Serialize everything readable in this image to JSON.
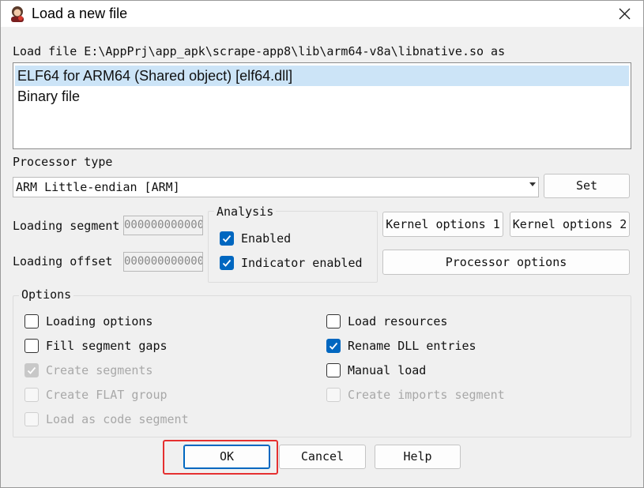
{
  "window": {
    "title": "Load a new file",
    "close_icon": "close-icon"
  },
  "load_file": {
    "label": "Load file E:\\AppPrj\\app_apk\\scrape-app8\\lib\\arm64-v8a\\libnative.so as"
  },
  "formats": [
    {
      "label": "ELF64 for ARM64 (Shared object) [elf64.dll]",
      "selected": true
    },
    {
      "label": "Binary file",
      "selected": false
    }
  ],
  "processor": {
    "label": "Processor type",
    "value": "ARM Little-endian [ARM]",
    "set_button": "Set"
  },
  "segment": {
    "loading_segment_label": "Loading segment",
    "loading_segment_value": "0000000000000",
    "loading_offset_label": "Loading offset",
    "loading_offset_value": "0000000000000"
  },
  "analysis": {
    "title": "Analysis",
    "enabled": {
      "label": "Enabled",
      "checked": true
    },
    "indicator": {
      "label": "Indicator enabled",
      "checked": true
    }
  },
  "buttons": {
    "kernel1": "Kernel options 1",
    "kernel2": "Kernel options 2",
    "processor_options": "Processor options",
    "ok": "OK",
    "cancel": "Cancel",
    "help": "Help"
  },
  "options": {
    "title": "Options",
    "left": [
      {
        "label": "Loading options",
        "checked": false,
        "enabled": true
      },
      {
        "label": "Fill segment gaps",
        "checked": false,
        "enabled": true
      },
      {
        "label": "Create segments",
        "checked": true,
        "enabled": false
      },
      {
        "label": "Create FLAT group",
        "checked": false,
        "enabled": false
      },
      {
        "label": "Load as code segment",
        "checked": false,
        "enabled": false
      }
    ],
    "right": [
      {
        "label": "Load resources",
        "checked": false,
        "enabled": true
      },
      {
        "label": "Rename DLL entries",
        "checked": true,
        "enabled": true
      },
      {
        "label": "Manual load",
        "checked": false,
        "enabled": true
      },
      {
        "label": "Create imports segment",
        "checked": false,
        "enabled": false
      }
    ]
  },
  "colors": {
    "accent": "#0067c0",
    "highlight": "#cce4f7",
    "annotation": "#e53030"
  }
}
